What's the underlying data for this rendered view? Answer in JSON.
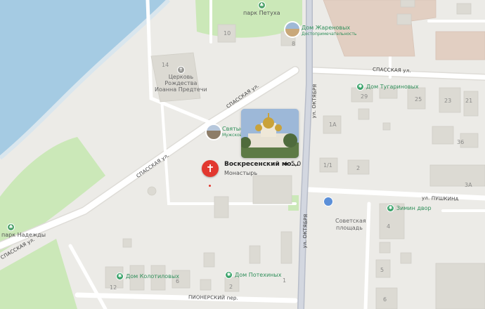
{
  "map": {
    "type": "street-map",
    "colors": {
      "water": "#a5cbe3",
      "park": "#cbe8b8",
      "road": "#ffffff",
      "major_road": "#c8ccd6",
      "building": "#dcdad3",
      "background": "#ecebe7",
      "accent_green": "#2f8f5a",
      "pin": "#e2382f"
    }
  },
  "streets": {
    "spasskaya_top": "СПАССКАЯ ул.",
    "spasskaya_diag1": "СПАССКАЯ ул.",
    "spasskaya_diag2": "СПАССКАЯ ул.",
    "spasskaya_left": "СПАССКАЯ ул.",
    "oktyabrya_upper": "ул. ОКТЯБРЯ",
    "oktyabrya_lower": "ул. ОКТЯБРЯ",
    "pushkina": "ул. ПУШКИНА",
    "pionerskiy": "ПИОНЕРСКИЙ пер."
  },
  "parks": {
    "petuha": "парк Петуха",
    "nadezhdy": "парк Надежды"
  },
  "places": {
    "church": "Церковь Рождества Иоанна Предтечи",
    "church_line1": "Церковь",
    "church_line2": "Рождества",
    "church_line3": "Иоанна Предтечи",
    "zharenovyh": "Дом Жареновых",
    "zharenovyh_sub": "Достопримечательность",
    "tugarinovyh": "Дом Тугариновых",
    "svyatye": "Святые",
    "svyatye_sub": "Мужской",
    "zimin": "Зимин двор",
    "kolotilovyh": "Дом Колотиловых",
    "potehinyh": "Дом Потехиных",
    "sovetskaya_line1": "Советская",
    "sovetskaya_line2": "площадь"
  },
  "selected": {
    "title": "Воскресенский мо...",
    "rating": "★ 5,0",
    "category": "Монастырь"
  },
  "house_numbers": [
    "10",
    "8",
    "14",
    "29",
    "25",
    "23",
    "21",
    "1А",
    "36",
    "1/1",
    "2",
    "3А",
    "4",
    "5",
    "6",
    "12",
    "6",
    "2",
    "1"
  ]
}
